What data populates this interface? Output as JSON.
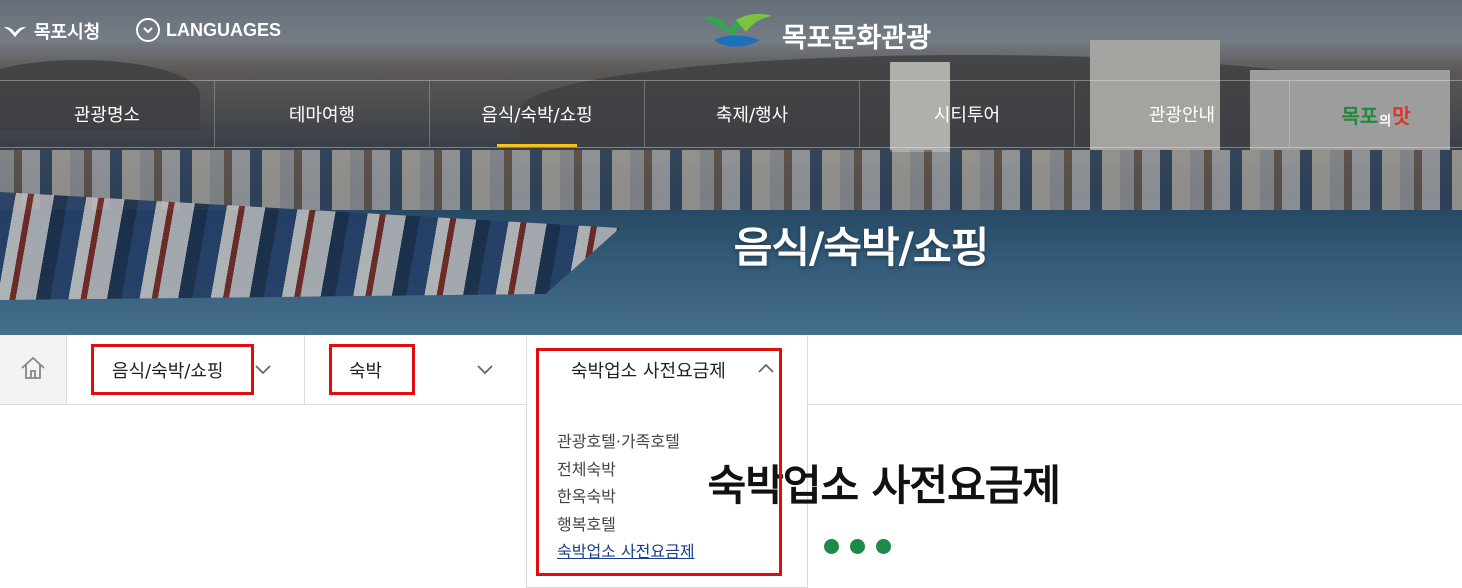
{
  "header": {
    "city_link": "목포시청",
    "languages_link": "LANGUAGES",
    "brand_name": "목포문화관광"
  },
  "gnb": {
    "items": [
      {
        "label": "관광명소"
      },
      {
        "label": "테마여행"
      },
      {
        "label": "음식/숙박/쇼핑",
        "active": true
      },
      {
        "label": "축제/행사"
      },
      {
        "label": "시티투어"
      },
      {
        "label": "관광안내"
      }
    ],
    "badge": {
      "part1": "목포",
      "part2": "의",
      "part3": "맛"
    }
  },
  "hero": {
    "title": "음식/숙박/쇼핑"
  },
  "breadcrumb": {
    "level1": "음식/숙박/쇼핑",
    "level2": "숙박",
    "level3": "숙박업소 사전요금제"
  },
  "dropdown": {
    "options": [
      {
        "label": "관광호텔·가족호텔"
      },
      {
        "label": "전체숙박"
      },
      {
        "label": "한옥숙박"
      },
      {
        "label": "행복호텔"
      },
      {
        "label": "숙박업소 사전요금제",
        "current": true
      }
    ]
  },
  "content": {
    "title": "숙박업소 사전요금제"
  },
  "colors": {
    "active_underline": "#f4c21c",
    "highlight_box": "#e10d0d",
    "current_link": "#1a3f8a",
    "dot": "#1e8a4a"
  },
  "icons": [
    "bird-icon",
    "globe-chevron-icon",
    "brand-logo-icon",
    "home-icon",
    "chevron-down-icon",
    "chevron-up-icon"
  ]
}
